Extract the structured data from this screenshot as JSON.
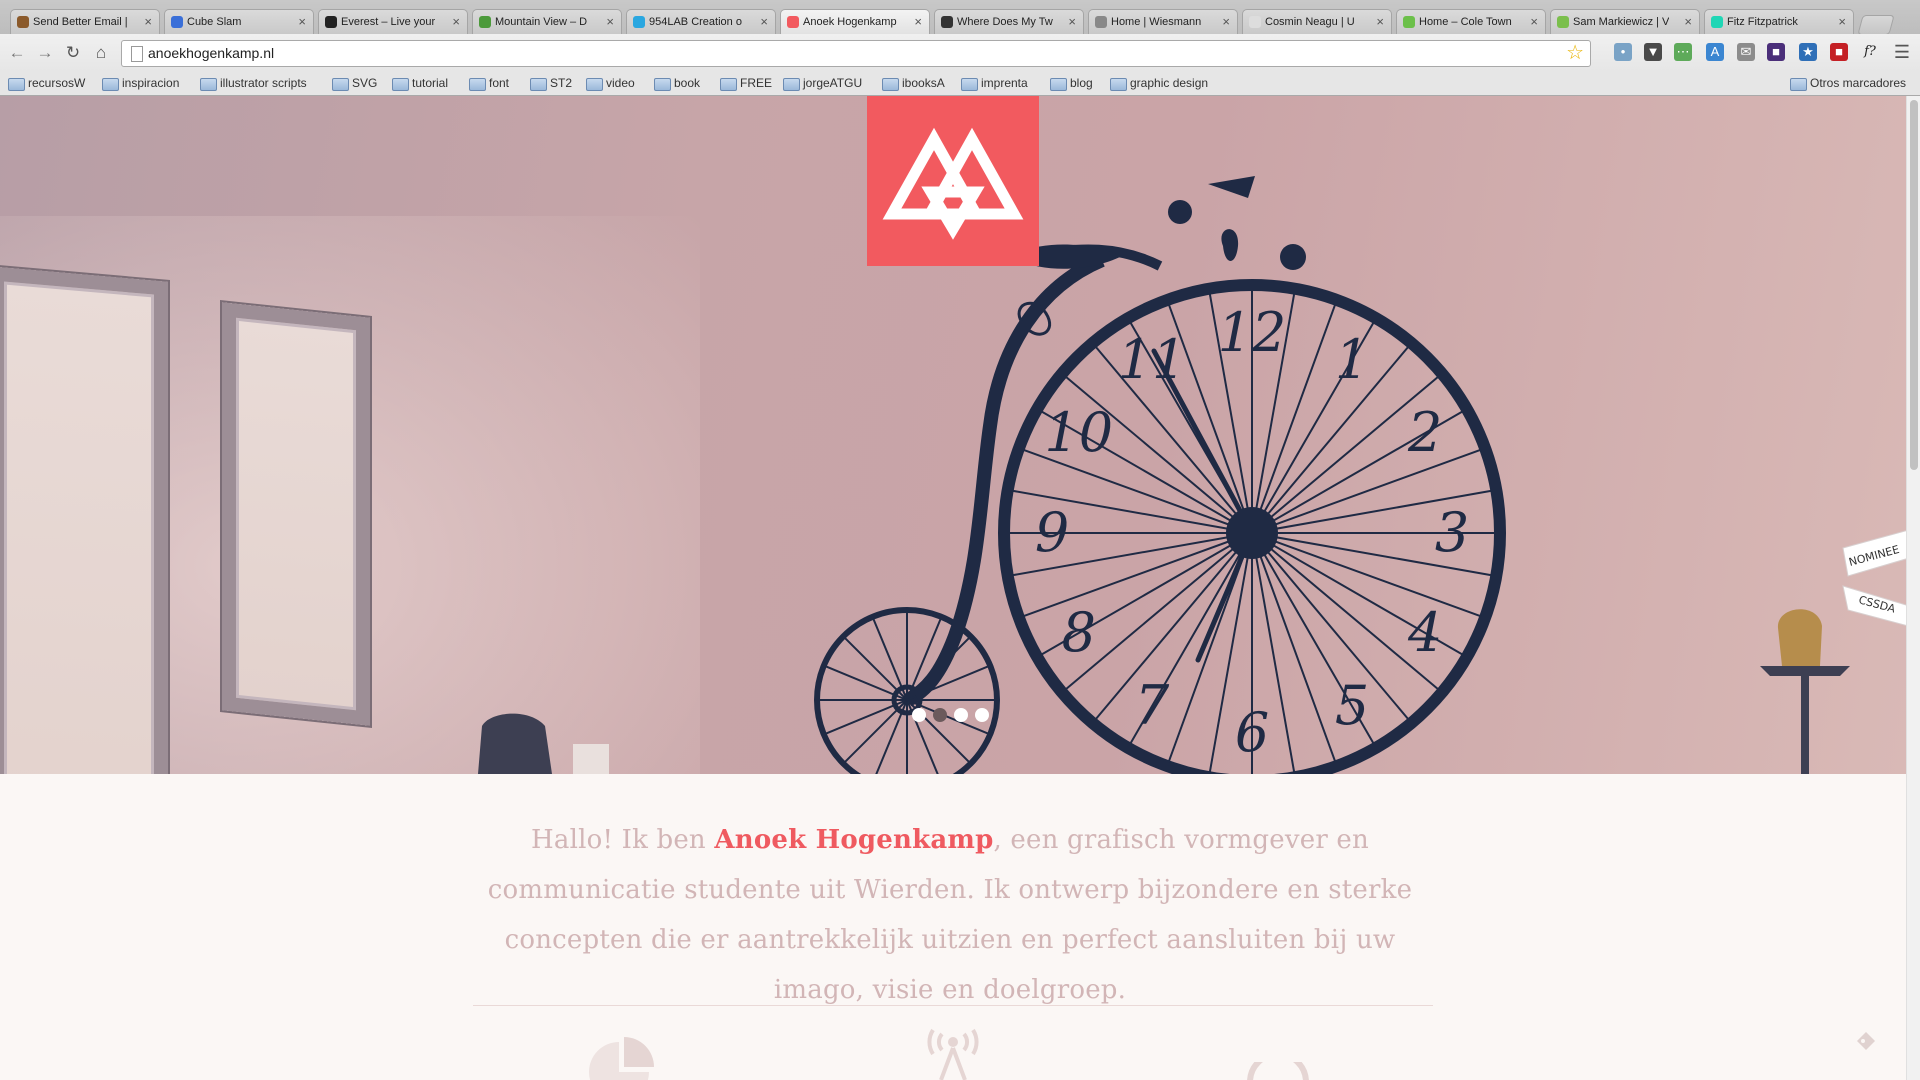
{
  "browser": {
    "tabs": [
      {
        "title": "Send Better Email |",
        "color": "#8b5a2b"
      },
      {
        "title": "Cube Slam",
        "color": "#3a6fd8"
      },
      {
        "title": "Everest – Live your",
        "color": "#222222"
      },
      {
        "title": "Mountain View – D",
        "color": "#4c9a3b"
      },
      {
        "title": "954LAB Creation o",
        "color": "#2aa7e0"
      },
      {
        "title": "Anoek Hogenkamp",
        "color": "#f25a5f"
      },
      {
        "title": "Where Does My Tw",
        "color": "#333333"
      },
      {
        "title": "Home | Wiesmann",
        "color": "#888888"
      },
      {
        "title": "Cosmin Neagu | U",
        "color": "#dddddd"
      },
      {
        "title": "Home – Cole Town",
        "color": "#6cc04a"
      },
      {
        "title": "Sam Markiewicz | V",
        "color": "#7bbf4c"
      },
      {
        "title": "Fitz Fitzpatrick",
        "color": "#1fd6b5"
      }
    ],
    "tab_close": "×",
    "url": "anoekhogenkamp.nl",
    "bookmarks": [
      "recursosW",
      "inspiracion",
      "illustrator scripts",
      "SVG",
      "tutorial",
      "font",
      "ST2",
      "video",
      "book",
      "FREE",
      "jorgeATGU",
      "ibooksA",
      "imprenta",
      "blog",
      "graphic design"
    ],
    "other_bookmarks": "Otros marcadores",
    "icons": {
      "back": "back-arrow-icon",
      "forward": "forward-arrow-icon",
      "reload": "reload-icon",
      "home": "home-icon",
      "star": "star-icon",
      "menu": "menu-icon"
    }
  },
  "hero": {
    "slides_total": 4,
    "active_slide": 2,
    "ribbon_top": "NOMINEE",
    "ribbon_bottom": "CSSDA",
    "logo_color": "#f25a5f"
  },
  "intro": {
    "prefix": "Hallo! Ik ben ",
    "name": "Anoek Hogenkamp",
    "suffix": ", een grafisch vormgever en communicatie studente uit Wierden. Ik ontwerp bijzondere en sterke concepten die er aantrekkelijk uitzien en perfect aansluiten bij uw imago, visie en doelgroep."
  },
  "colors": {
    "accent": "#f25a5f",
    "intro_text": "#d2b5b6",
    "clock_ink": "#1f2a44"
  }
}
